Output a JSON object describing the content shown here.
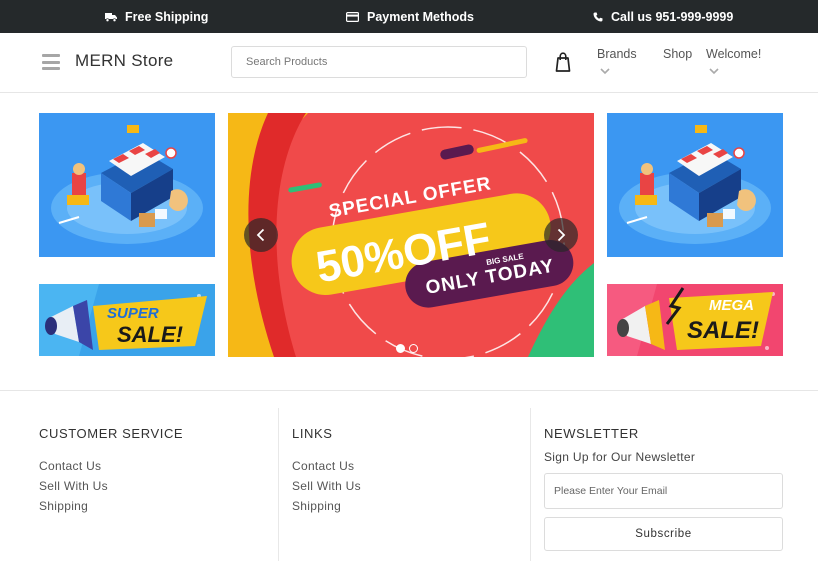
{
  "topbar": {
    "shipping": "Free Shipping",
    "payment": "Payment Methods",
    "call": "Call us 951-999-9999"
  },
  "header": {
    "brand": "MERN Store",
    "search_placeholder": "Search Products",
    "nav": {
      "brands": "Brands",
      "shop": "Shop",
      "welcome": "Welcome!"
    }
  },
  "hero": {
    "left_top_image": "shopping-isometric-illustration",
    "left_bottom_image": {
      "line1": "SUPER",
      "line2": "SALE!"
    },
    "right_top_image": "shopping-isometric-illustration",
    "right_bottom_image": {
      "line1": "MEGA",
      "line2": "SALE!"
    },
    "carousel": {
      "heading": "SPECIAL OFFER",
      "discount": "50%OFF",
      "tag": "BIG SALE",
      "footer": "ONLY TODAY",
      "slide_count": 2,
      "active_slide": 1
    }
  },
  "footer": {
    "customer_service": {
      "title": "CUSTOMER SERVICE",
      "links": [
        "Contact Us",
        "Sell With Us",
        "Shipping"
      ]
    },
    "links": {
      "title": "LINKS",
      "links": [
        "Contact Us",
        "Sell With Us",
        "Shipping"
      ]
    },
    "newsletter": {
      "title": "NEWSLETTER",
      "subtitle": "Sign Up for Our Newsletter",
      "email_placeholder": "Please Enter Your Email",
      "button": "Subscribe"
    }
  },
  "colors": {
    "topbar_bg": "#25292b",
    "blue_tile": "#3b97f2",
    "offer_red": "#f04a4a",
    "offer_yellow": "#f6b816",
    "offer_purple": "#5a1a4f",
    "mega_pink": "#f2466f"
  }
}
